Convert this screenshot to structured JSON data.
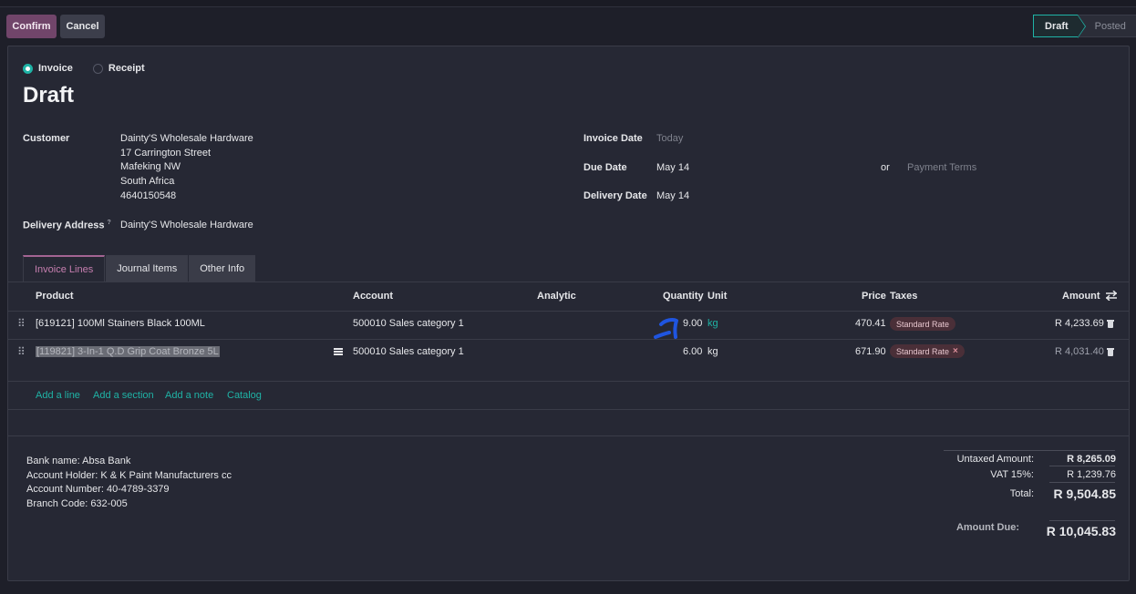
{
  "toolbar": {
    "confirm_label": "Confirm",
    "cancel_label": "Cancel"
  },
  "statusbar": {
    "stages": [
      "Draft",
      "Posted"
    ],
    "active": "Draft"
  },
  "form": {
    "move_type": {
      "options": [
        "Invoice",
        "Receipt"
      ],
      "selected": "Invoice"
    },
    "title": "Draft",
    "customer_label": "Customer",
    "customer_lines": [
      "Dainty'S Wholesale Hardware",
      "17 Carrington Street",
      "Mafeking NW",
      "South Africa",
      "4640150548"
    ],
    "delivery_label": "Delivery Address",
    "delivery_help": "?",
    "delivery_value": "Dainty'S Wholesale Hardware",
    "invoice_date_label": "Invoice Date",
    "invoice_date_placeholder": "Today",
    "due_date_label": "Due Date",
    "due_date_value": "May 14",
    "or_label": "or",
    "payment_terms_placeholder": "Payment Terms",
    "delivery_date_label": "Delivery Date",
    "delivery_date_value": "May 14"
  },
  "tabs": [
    "Invoice Lines",
    "Journal Items",
    "Other Info"
  ],
  "table": {
    "headers": {
      "product": "Product",
      "account": "Account",
      "analytic": "Analytic",
      "quantity": "Quantity",
      "unit": "Unit",
      "price": "Price",
      "taxes": "Taxes",
      "amount": "Amount"
    },
    "rows": [
      {
        "product": "[619121] 100Ml Stainers Black 100ML",
        "account": "500010 Sales category 1",
        "quantity": "9.00",
        "unit": "kg",
        "price": "470.41",
        "tax": "Standard Rate",
        "amount": "R 4,233.69"
      },
      {
        "product": "[119821] 3-In-1 Q.D Grip Coat Bronze 5L",
        "account": "500010 Sales category 1",
        "quantity": "6.00",
        "unit": "kg",
        "price": "671.90",
        "tax": "Standard Rate",
        "amount": "R 4,031.40"
      }
    ],
    "add_links": [
      "Add a line",
      "Add a section",
      "Add a note",
      "Catalog"
    ]
  },
  "narration": [
    "Bank name: Absa Bank",
    "Account Holder: K & K Paint Manufacturers cc",
    "Account Number: 40-4789-3379",
    "Branch Code: 632-005"
  ],
  "totals": {
    "untaxed_label": "Untaxed Amount:",
    "untaxed_value": "R 8,265.09",
    "vat_label": "VAT 15%:",
    "vat_value": "R 1,239.76",
    "total_label": "Total:",
    "total_value": "R 9,504.85",
    "due_label": "Amount Due:",
    "due_value": "R 10,045.83"
  },
  "colors": {
    "accent": "#1fb3a6",
    "primary": "#71456a",
    "background": "#1e1f29",
    "sheet": "#262834"
  }
}
